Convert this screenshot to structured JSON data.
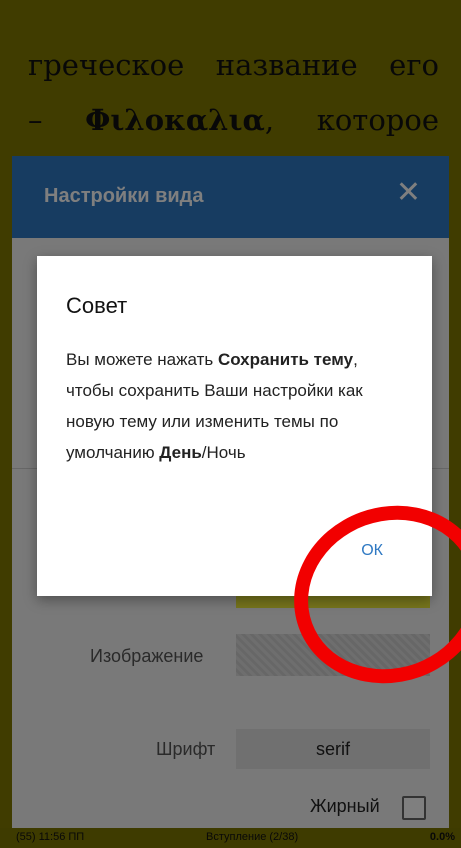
{
  "reader": {
    "line1": [
      "греческое",
      "название",
      "его"
    ],
    "line2_dash": "–",
    "line2_bold": "Φιλοκαλια",
    "line2_comma": ",",
    "line2_end": "которое"
  },
  "settings": {
    "title": "Настройки вида",
    "close_icon": "close-icon",
    "image_label": "Изображение",
    "font_label": "Шрифт",
    "font_value": "serif",
    "bold_label": "Жирный"
  },
  "dialog": {
    "title": "Совет",
    "msg_1": "Вы можете нажать ",
    "msg_bold_1": "Сохранить тему",
    "msg_2": ", чтобы сохранить Ваши настройки как новую тему или изменить темы по умолчанию ",
    "msg_bold_2": "День",
    "msg_3": "/Ночь",
    "ok_label": "ОК"
  },
  "status": {
    "left": "(55) 11:56 ПП",
    "middle": "Вступление (2/38)",
    "right": "0.0%"
  },
  "colors": {
    "reader_bg": "#807800",
    "header_blue": "#2f79c3",
    "annotation_red": "#f20000"
  }
}
